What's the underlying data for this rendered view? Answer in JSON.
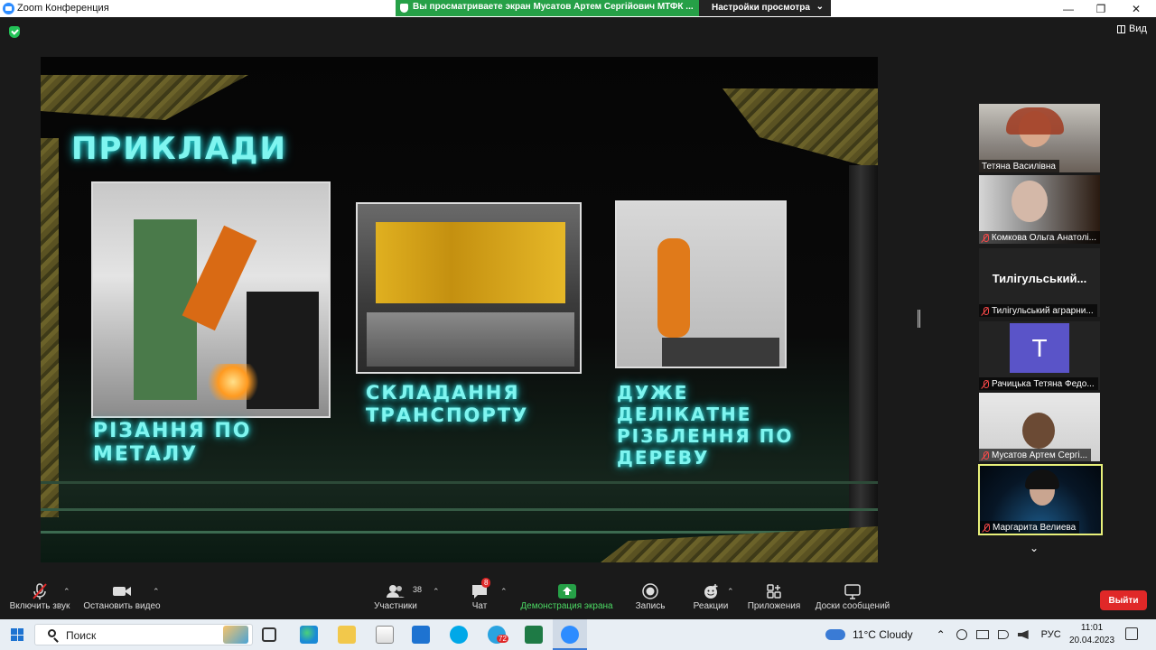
{
  "window": {
    "title": "Zoom Конференция"
  },
  "share_banner": {
    "text": "Вы просматриваете экран Мусатов Артем Сергійович МТФК ...",
    "view_settings": "Настройки просмотра"
  },
  "view_button": {
    "label": "Вид"
  },
  "slide": {
    "title": "Приклади",
    "captions": [
      {
        "line1": "Різання по",
        "line2": "металу",
        "line3": ""
      },
      {
        "line1": "Складання",
        "line2": "транспорту",
        "line3": ""
      },
      {
        "line1": "Дуже",
        "line2": "делікатне",
        "line3": "різблення по",
        "line4": "дереву"
      }
    ]
  },
  "participants": [
    {
      "name": "Тетяна Василівна",
      "muted": false,
      "kind": "video"
    },
    {
      "name": "Комкова Ольга Анатолі...",
      "muted": true,
      "kind": "video"
    },
    {
      "name": "Тилігульський аграрни...",
      "muted": true,
      "kind": "text",
      "display_name": "Тилігульський..."
    },
    {
      "name": "Рачицька Тетяна Федо...",
      "muted": true,
      "kind": "avatar",
      "initial": "T"
    },
    {
      "name": "Мусатов Артем Сергі...",
      "muted": true,
      "kind": "video"
    },
    {
      "name": "Маргарита Велиева",
      "muted": true,
      "kind": "video",
      "active": true
    }
  ],
  "toolbar": {
    "unmute": "Включить звук",
    "video": "Остановить видео",
    "participants": "Участники",
    "participants_count": "38",
    "chat": "Чат",
    "chat_badge": "8",
    "share": "Демонстрация экрана",
    "record": "Запись",
    "reactions": "Реакции",
    "apps": "Приложения",
    "whiteboards": "Доски сообщений",
    "leave": "Выйти"
  },
  "taskbar": {
    "search_placeholder": "Поиск",
    "weather": "11°C  Cloudy",
    "lang": "РУС",
    "time": "11:01",
    "date": "20.04.2023",
    "telegram_badge": "72"
  },
  "colors": {
    "accent_green": "#26a047",
    "leave_red": "#e02828",
    "neon": "#7ff5f0",
    "active_speaker": "#e8f07a"
  }
}
